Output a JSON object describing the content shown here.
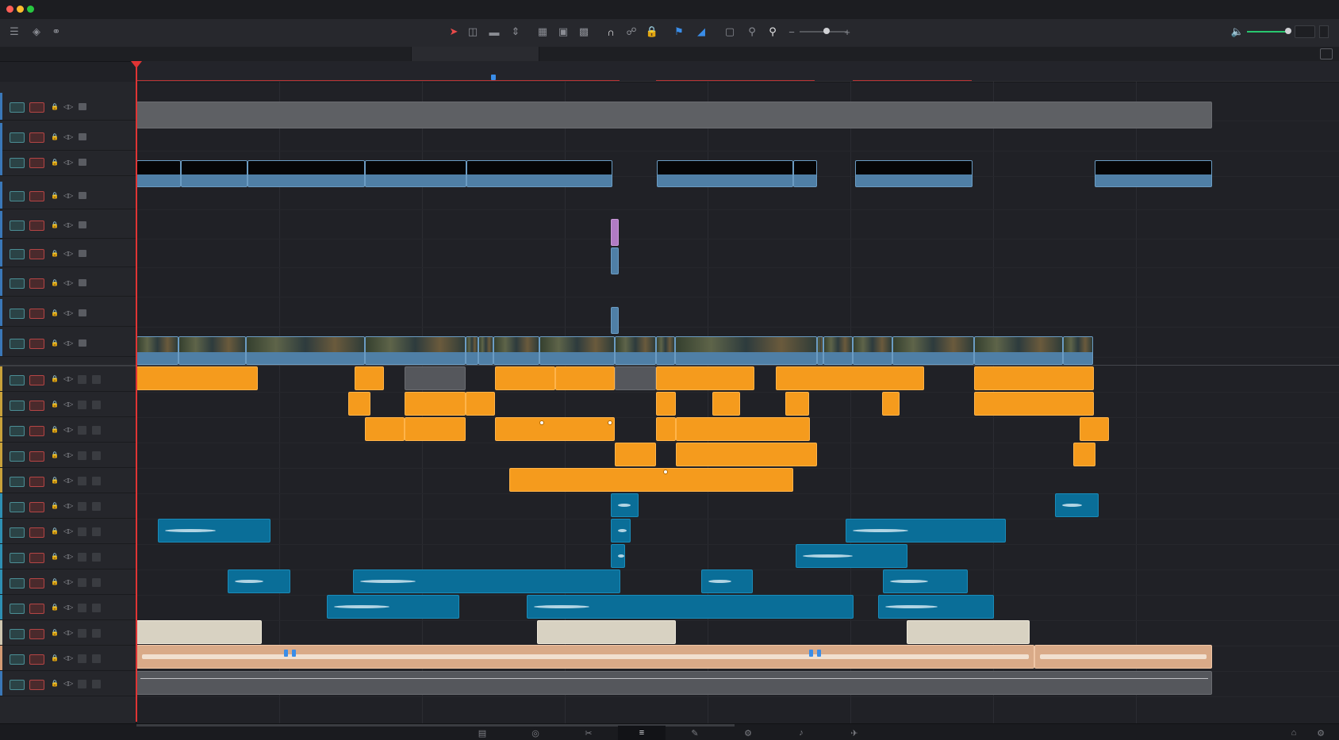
{
  "window": {
    "traffic_lights": [
      "#fe5f57",
      "#febc2e",
      "#28c840"
    ]
  },
  "toolbar": {
    "left_icons": [
      "timeline-view-icon",
      "track-height-icon",
      "microphone-icon"
    ],
    "tools": [
      "selection-icon",
      "trim-icon",
      "blade-icon",
      "dynamic-trim-icon",
      "insert-icon",
      "overwrite-icon",
      "replace-icon",
      "snapping-icon",
      "linked-selection-icon",
      "position-lock-icon",
      "flag-icon",
      "marker-icon",
      "zoom-full-icon",
      "zoom-detail-icon",
      "zoom-custom-icon",
      "zoom-out-icon",
      "zoom-in-icon"
    ],
    "volume_icon": "speaker-icon",
    "accent": "#28c76f"
  },
  "colors": {
    "video": "#4f7fa6",
    "audio_orange": "#f59b1d",
    "audio_blue": "#0a6e98",
    "audio_cream": "#d8d2c2",
    "audio_peach": "#d9aa88",
    "playhead": "#e03434"
  },
  "video_tracks": 9,
  "audio_tracks": 13,
  "pages": [
    "media-page-icon",
    "cut-page-icon",
    "edit-page-icon",
    "fusion-page-icon",
    "color-page-icon",
    "fairlight-page-icon",
    "music-page-icon",
    "deliver-page-icon"
  ],
  "active_page_index": 3,
  "bottom_right_icons": [
    "home-icon",
    "settings-icon"
  ]
}
